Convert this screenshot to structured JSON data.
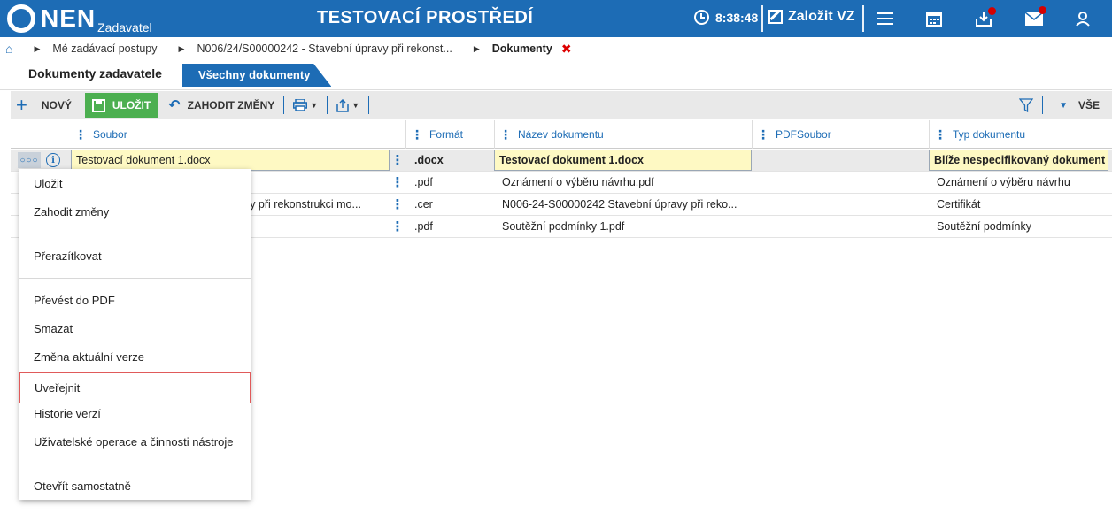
{
  "header": {
    "logo_text": "NEN",
    "logo_sub": "Zadavatel",
    "env_title": "TESTOVACÍ PROSTŘEDÍ",
    "clock": "8:38:48",
    "new_vz_label": "Založit VZ",
    "accent_color": "#1d6cb5"
  },
  "breadcrumb": {
    "items": [
      "Mé zadávací postupy",
      "N006/24/S00000242 - Stavební úpravy při rekonst...",
      "Dokumenty"
    ]
  },
  "tabs": {
    "active": "Dokumenty zadavatele",
    "other": "Všechny dokumenty"
  },
  "toolbar": {
    "new_label": "NOVÝ",
    "save_label": "ULOŽIT",
    "discard_label": "ZAHODIT ZMĚNY",
    "view_label": "VŠE"
  },
  "grid": {
    "columns": [
      "Soubor",
      "Formát",
      "Název dokumentu",
      "PDFSoubor",
      "Typ dokumentu"
    ],
    "rows": [
      {
        "soubor": "Testovací dokument 1.docx",
        "format": ".docx",
        "nazev": "Testovací dokument 1.docx",
        "pdf": "",
        "typ": "Blíže nespecifikovaný dokument"
      },
      {
        "soubor": "",
        "format": ".pdf",
        "nazev": "Oznámení o výběru návrhu.pdf",
        "pdf": "",
        "typ": "Oznámení o výběru návrhu"
      },
      {
        "soubor": "avy při rekonstrukci mo...",
        "format": ".cer",
        "nazev": "N006-24-S00000242 Stavební úpravy při reko...",
        "pdf": "",
        "typ": "Certifikát"
      },
      {
        "soubor": "",
        "format": ".pdf",
        "nazev": "Soutěžní podmínky 1.pdf",
        "pdf": "",
        "typ": "Soutěžní podmínky"
      }
    ]
  },
  "context_menu": {
    "items": [
      "Uložit",
      "Zahodit změny",
      "Přerazítkovat",
      "Převést do PDF",
      "Smazat",
      "Změna aktuální verze",
      "Uveřejnit",
      "Historie verzí",
      "Uživatelské operace a činnosti nástroje",
      "Otevřít samostatně"
    ]
  }
}
